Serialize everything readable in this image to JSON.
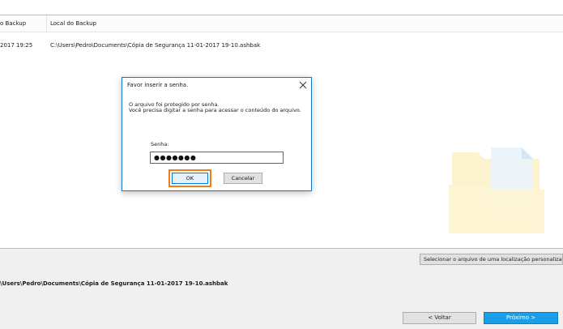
{
  "table": {
    "columns": [
      "o Backup",
      "Local do Backup"
    ],
    "rows": [
      {
        "date": "2017 19:25",
        "location": "C:\\Users\\Pedro\\Documents\\Cópia de Segurança 11-01-2017 19-10.ashbak"
      }
    ]
  },
  "dialog": {
    "title": "Favor inserir a senha.",
    "line1": "O arquivo foi protegido por senha.",
    "line2": "Você precisa digitar a senha para acessar o conteúdo do arquivo.",
    "password_label": "Senha:",
    "password_value": "●●●●●●●",
    "ok_label": "OK",
    "cancel_label": "Cancelar"
  },
  "lower": {
    "custom_location_button": "Selecionar o arquivo de uma localização personalizada...",
    "selected_path": "\\Users\\Pedro\\Documents\\Cópia de Segurança 11-01-2017 19-10.ashbak"
  },
  "footer": {
    "back_label": "< Voltar",
    "next_label": "Próximo >"
  },
  "colors": {
    "accent": "#1a9ee8",
    "highlight_ring": "#f07c1a",
    "dialog_border": "#1778c8"
  },
  "icons": [
    "close-icon",
    "folder-illustration"
  ]
}
